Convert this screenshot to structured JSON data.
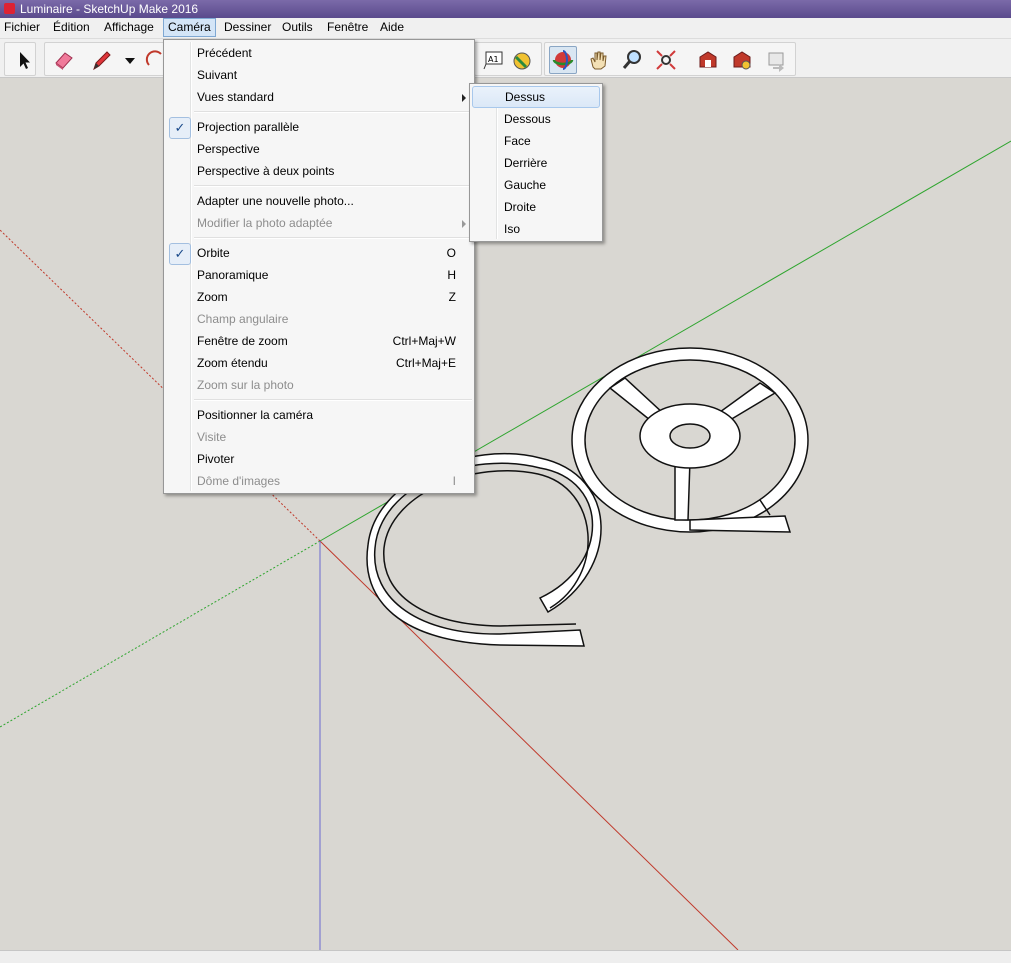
{
  "window": {
    "title": "Luminaire - SketchUp Make 2016"
  },
  "menubar": {
    "items": [
      {
        "label": "Fichier"
      },
      {
        "label": "Édition"
      },
      {
        "label": "Affichage"
      },
      {
        "label": "Caméra"
      },
      {
        "label": "Dessiner"
      },
      {
        "label": "Outils"
      },
      {
        "label": "Fenêtre"
      },
      {
        "label": "Aide"
      }
    ],
    "active": "Caméra"
  },
  "toolbar": {
    "tools": [
      "select-icon",
      "eraser-icon",
      "pencil-icon",
      "dropdown-arrow-icon",
      "arc-icon",
      "text-icon",
      "paint-bucket-icon",
      "orbit-icon",
      "pan-hand-icon",
      "zoom-icon",
      "zoom-extents-icon",
      "warehouse-icon",
      "extension-icon",
      "share-icon"
    ],
    "text_tool_label": "A1"
  },
  "camera_menu": {
    "items": [
      {
        "label": "Précédent",
        "shortcut": "",
        "disabled": false,
        "checked": false,
        "submenu": false
      },
      {
        "label": "Suivant",
        "shortcut": "",
        "disabled": false,
        "checked": false,
        "submenu": false
      },
      {
        "label": "Vues standard",
        "shortcut": "",
        "disabled": false,
        "checked": false,
        "submenu": true
      },
      {
        "label": "Projection parallèle",
        "shortcut": "",
        "disabled": false,
        "checked": true,
        "submenu": false
      },
      {
        "label": "Perspective",
        "shortcut": "",
        "disabled": false,
        "checked": false,
        "submenu": false
      },
      {
        "label": "Perspective à deux points",
        "shortcut": "",
        "disabled": false,
        "checked": false,
        "submenu": false
      },
      {
        "label": "Adapter une nouvelle photo...",
        "shortcut": "",
        "disabled": false,
        "checked": false,
        "submenu": false
      },
      {
        "label": "Modifier la photo adaptée",
        "shortcut": "",
        "disabled": true,
        "checked": false,
        "submenu": true
      },
      {
        "label": "Orbite",
        "shortcut": "O",
        "disabled": false,
        "checked": true,
        "submenu": false
      },
      {
        "label": "Panoramique",
        "shortcut": "H",
        "disabled": false,
        "checked": false,
        "submenu": false
      },
      {
        "label": "Zoom",
        "shortcut": "Z",
        "disabled": false,
        "checked": false,
        "submenu": false
      },
      {
        "label": "Champ angulaire",
        "shortcut": "",
        "disabled": true,
        "checked": false,
        "submenu": false
      },
      {
        "label": "Fenêtre de zoom",
        "shortcut": "Ctrl+Maj+W",
        "disabled": false,
        "checked": false,
        "submenu": false
      },
      {
        "label": "Zoom étendu",
        "shortcut": "Ctrl+Maj+E",
        "disabled": false,
        "checked": false,
        "submenu": false
      },
      {
        "label": "Zoom sur la photo",
        "shortcut": "",
        "disabled": true,
        "checked": false,
        "submenu": false
      },
      {
        "label": "Positionner la caméra",
        "shortcut": "",
        "disabled": false,
        "checked": false,
        "submenu": false
      },
      {
        "label": "Visite",
        "shortcut": "",
        "disabled": true,
        "checked": false,
        "submenu": false
      },
      {
        "label": "Pivoter",
        "shortcut": "",
        "disabled": false,
        "checked": false,
        "submenu": false
      },
      {
        "label": "Dôme d'images",
        "shortcut": "I",
        "disabled": true,
        "checked": false,
        "submenu": false
      }
    ],
    "checkmark": "✓"
  },
  "standard_views_submenu": {
    "items": [
      {
        "label": "Dessus",
        "highlighted": true
      },
      {
        "label": "Dessous",
        "highlighted": false
      },
      {
        "label": "Face",
        "highlighted": false
      },
      {
        "label": "Derrière",
        "highlighted": false
      },
      {
        "label": "Gauche",
        "highlighted": false
      },
      {
        "label": "Droite",
        "highlighted": false
      },
      {
        "label": "Iso",
        "highlighted": false
      }
    ]
  },
  "colors": {
    "axis_red": "#c0392b",
    "axis_green": "#2fa52f",
    "axis_blue": "#3b3bcf",
    "background": "#d9d7d2"
  }
}
